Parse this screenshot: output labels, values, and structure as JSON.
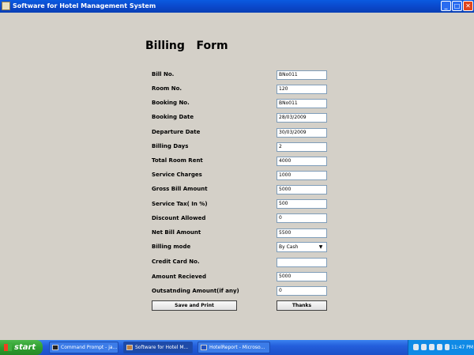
{
  "window": {
    "title": "Software for Hotel Management System",
    "min_label": "_",
    "max_label": "□",
    "close_label": "✕"
  },
  "form": {
    "title": "Billing   Form",
    "fields": [
      {
        "label": "Bill No.",
        "value": "BNo011"
      },
      {
        "label": "Room No.",
        "value": "120"
      },
      {
        "label": "Booking No.",
        "value": "BNo011"
      },
      {
        "label": "Booking Date",
        "value": "28/03/2009"
      },
      {
        "label": "Departure Date",
        "value": "30/03/2009"
      },
      {
        "label": "Billing Days",
        "value": "2"
      },
      {
        "label": "Total Room Rent",
        "value": "4000"
      },
      {
        "label": "Service Charges",
        "value": "1000"
      },
      {
        "label": "Gross Bill Amount",
        "value": "5000"
      },
      {
        "label": "Service Tax( In %)",
        "value": "500"
      },
      {
        "label": "Discount Allowed",
        "value": "0"
      },
      {
        "label": "Net Bill Amount",
        "value": "5500"
      },
      {
        "label": "Billing mode",
        "value": "By Cash"
      },
      {
        "label": "Credit Card No.",
        "value": ""
      },
      {
        "label": "Amount Recieved",
        "value": "5000"
      },
      {
        "label": "Outsatnding Amount(if any)",
        "value": "0"
      }
    ],
    "save_label": "Save and Print",
    "thanks_label": "Thanks"
  },
  "taskbar": {
    "start_label": "start",
    "tasks": [
      {
        "label": "Command Prompt - ja..."
      },
      {
        "label": "Software for Hotel M..."
      },
      {
        "label": "HotelReport - Microso..."
      }
    ],
    "clock": "11:47 PM"
  },
  "icons": [
    "app-icon",
    "minimize-icon",
    "maximize-icon",
    "close-icon",
    "dropdown-arrow-icon",
    "windows-flag-icon",
    "command-prompt-icon",
    "java-app-icon",
    "word-document-icon",
    "tray-icon"
  ],
  "colors": {
    "titlebar": "#0a46c8",
    "taskbar": "#245edb",
    "start": "#2f9e2f",
    "background": "#d4d0c8"
  }
}
